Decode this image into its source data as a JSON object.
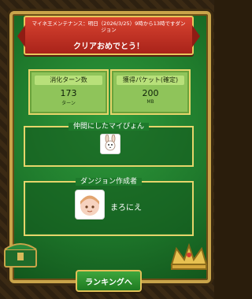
{
  "banner": {
    "notice": "マイネ王メンテナンス：明日（2026/3/25）9時から13時ですダンジョン",
    "title": "クリアおめでとう！"
  },
  "stats": [
    {
      "label": "消化ターン数",
      "value": "173",
      "unit": "ターン"
    },
    {
      "label": "獲得パケット(確定)",
      "value": "200",
      "unit": "MB"
    }
  ],
  "sections": {
    "companions_title": "仲間にしたマイぴょん",
    "creator_title": "ダンジョン作成者",
    "creator_name": "まろにえ"
  },
  "buttons": {
    "ranking": "ランキングへ"
  },
  "icons": {
    "pet": "bunny-icon",
    "creator_avatar": "avatar",
    "chest": "treasure-chest-icon",
    "crown": "crown-icon"
  }
}
